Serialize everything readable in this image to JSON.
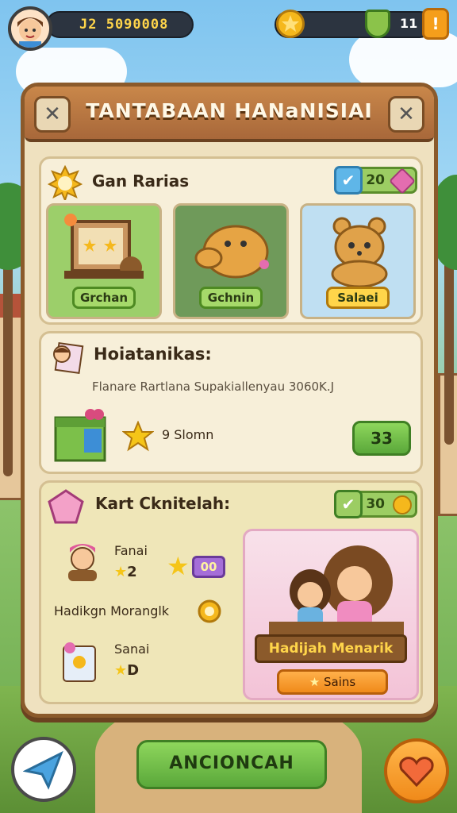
{
  "topbar": {
    "coins": "J2 5090008",
    "right_value": "11",
    "plus": "!"
  },
  "panel": {
    "title": "TANTABAAN HANaNISIAI"
  },
  "section1": {
    "title": "Gan Rarias",
    "badge_value": "20",
    "tiles": [
      {
        "label": "Grchan"
      },
      {
        "label": "Gchnin"
      },
      {
        "label": "Salaei"
      }
    ]
  },
  "section2": {
    "title": "Hoiatanikas:",
    "description": "Flanare Rartlana Supakiallenyau 3060K.J",
    "reward_text": "9 Slomn",
    "button": "33"
  },
  "section3": {
    "title": "Kart Cknitelah:",
    "badge_value": "30",
    "item1_name": "Fanai",
    "item1_stars": "2",
    "item1_counter": "00",
    "hadikan_text": "Hadikgn Moranglk",
    "item2_name": "Sanai",
    "item2_stars": "D",
    "promo_title": "Hadijah Menarik",
    "promo_button": "Sains"
  },
  "bottom": {
    "main_button": "ANCIONCAH"
  }
}
